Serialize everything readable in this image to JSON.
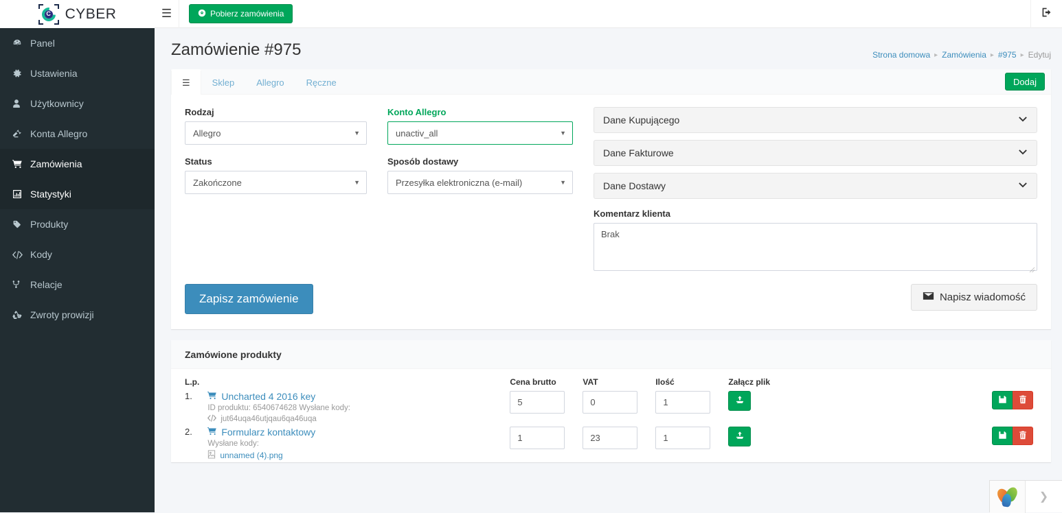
{
  "brand": {
    "text": "CYBER",
    "logo_icon": "cyber-c-logo"
  },
  "topbar": {
    "hamburger_icon": "hamburger-icon",
    "fetch_orders_label": "Pobierz zamówienia",
    "fetch_orders_icon": "download-circle-icon",
    "logout_icon": "sign-out-icon"
  },
  "sidebar": {
    "items": [
      {
        "label": "Panel",
        "icon": "dashboard-icon",
        "active": false
      },
      {
        "label": "Ustawienia",
        "icon": "gear-icon",
        "active": false
      },
      {
        "label": "Użytkownicy",
        "icon": "user-icon",
        "active": false
      },
      {
        "label": "Konta Allegro",
        "icon": "gavel-icon",
        "active": false
      },
      {
        "label": "Zamówienia",
        "icon": "cart-icon",
        "active": true
      },
      {
        "label": "Statystyki",
        "icon": "bar-chart-icon",
        "active": true
      },
      {
        "label": "Produkty",
        "icon": "tags-icon",
        "active": false
      },
      {
        "label": "Kody",
        "icon": "code-icon",
        "active": false
      },
      {
        "label": "Relacje",
        "icon": "sitemap-icon",
        "active": false
      },
      {
        "label": "Zwroty prowizji",
        "icon": "recycle-icon",
        "active": false
      }
    ]
  },
  "page": {
    "title": "Zamówienie #975",
    "breadcrumb": [
      {
        "label": "Strona domowa",
        "current": false
      },
      {
        "label": "Zamówienia",
        "current": false
      },
      {
        "label": "#975",
        "current": false
      },
      {
        "label": "Edytuj",
        "current": true
      }
    ]
  },
  "tabs": {
    "items": [
      {
        "label": "",
        "icon": "hamburger-icon",
        "active": true
      },
      {
        "label": "Sklep",
        "icon": "",
        "active": false
      },
      {
        "label": "Allegro",
        "icon": "",
        "active": false
      },
      {
        "label": "Ręczne",
        "icon": "",
        "active": false
      }
    ],
    "add_label": "Dodaj"
  },
  "form": {
    "rodzaj": {
      "label": "Rodzaj",
      "value": "Allegro"
    },
    "status": {
      "label": "Status",
      "value": "Zakończone"
    },
    "konto_allegro": {
      "label": "Konto Allegro",
      "value": "unactiv_all"
    },
    "sposob_dostawy": {
      "label": "Sposób dostawy",
      "value": "Przesyłka elektroniczna (e-mail)"
    },
    "panels": [
      {
        "label": "Dane Kupującego",
        "chevron": "chevron-down-icon"
      },
      {
        "label": "Dane Fakturowe",
        "chevron": "chevron-down-icon"
      },
      {
        "label": "Dane Dostawy",
        "chevron": "chevron-down-icon"
      }
    ],
    "comment": {
      "label": "Komentarz klienta",
      "value": "Brak"
    },
    "save_label": "Zapisz zamówienie",
    "message_label": "Napisz wiadomość",
    "message_icon": "envelope-icon"
  },
  "products": {
    "section_title": "Zamówione produkty",
    "columns": {
      "index": "L.p.",
      "name": "",
      "price": "Cena brutto",
      "vat": "VAT",
      "qty": "Ilość",
      "file": "Załącz plik",
      "actions": ""
    },
    "rows": [
      {
        "index": "1.",
        "name": "Uncharted 4 2016 key",
        "name_icon": "cart-icon",
        "meta": "ID produktu: 6540674628 Wysłane kody:",
        "code_icon": "code-icon",
        "code": "jut64uqa46utjqau6qa46uqa",
        "file_icon": "",
        "file": "",
        "price": "5",
        "vat": "0",
        "qty": "1",
        "upload_icon": "upload-icon",
        "save_icon": "floppy-save-icon",
        "delete_icon": "trash-icon"
      },
      {
        "index": "2.",
        "name": "Formularz kontaktowy",
        "name_icon": "cart-icon",
        "meta": "Wysłane kody:",
        "code_icon": "",
        "code": "",
        "file_icon": "file-image-icon",
        "file": "unnamed (4).png",
        "price": "1",
        "vat": "23",
        "qty": "1",
        "upload_icon": "upload-icon",
        "save_icon": "floppy-save-icon",
        "delete_icon": "trash-icon"
      }
    ]
  },
  "chat_widget": {
    "logo_icon": "flower-logo-icon",
    "expand_icon": "chevron-right-icon"
  },
  "colors": {
    "sidebar_bg": "#222d32",
    "accent_green": "#00a65a",
    "accent_blue": "#3c8dbc",
    "danger_red": "#dd4b39",
    "link_blue": "#3c8dbc"
  }
}
